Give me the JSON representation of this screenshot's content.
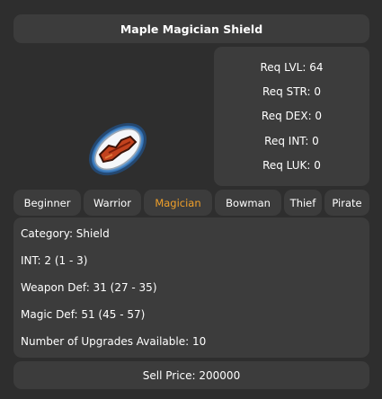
{
  "item": {
    "name": "Maple Magician Shield",
    "icon": "maple-magician-shield-icon"
  },
  "requirements": [
    "Req LVL: 64",
    "Req STR: 0",
    "Req DEX: 0",
    "Req INT: 0",
    "Req LUK: 0"
  ],
  "jobs": [
    {
      "label": "Beginner",
      "active": false
    },
    {
      "label": "Warrior",
      "active": false
    },
    {
      "label": "Magician",
      "active": true
    },
    {
      "label": "Bowman",
      "active": false
    },
    {
      "label": "Thief",
      "active": false
    },
    {
      "label": "Pirate",
      "active": false
    }
  ],
  "stats": [
    "Category: Shield",
    "INT: 2 (1 - 3)",
    "Weapon Def: 31 (27 - 35)",
    "Magic Def: 51 (45 - 57)",
    "Number of Upgrades Available: 10"
  ],
  "sell_price": "Sell Price: 200000",
  "colors": {
    "background": "#2e2e2e",
    "panel": "#3c3c3c",
    "active_job": "#f0a02a"
  }
}
